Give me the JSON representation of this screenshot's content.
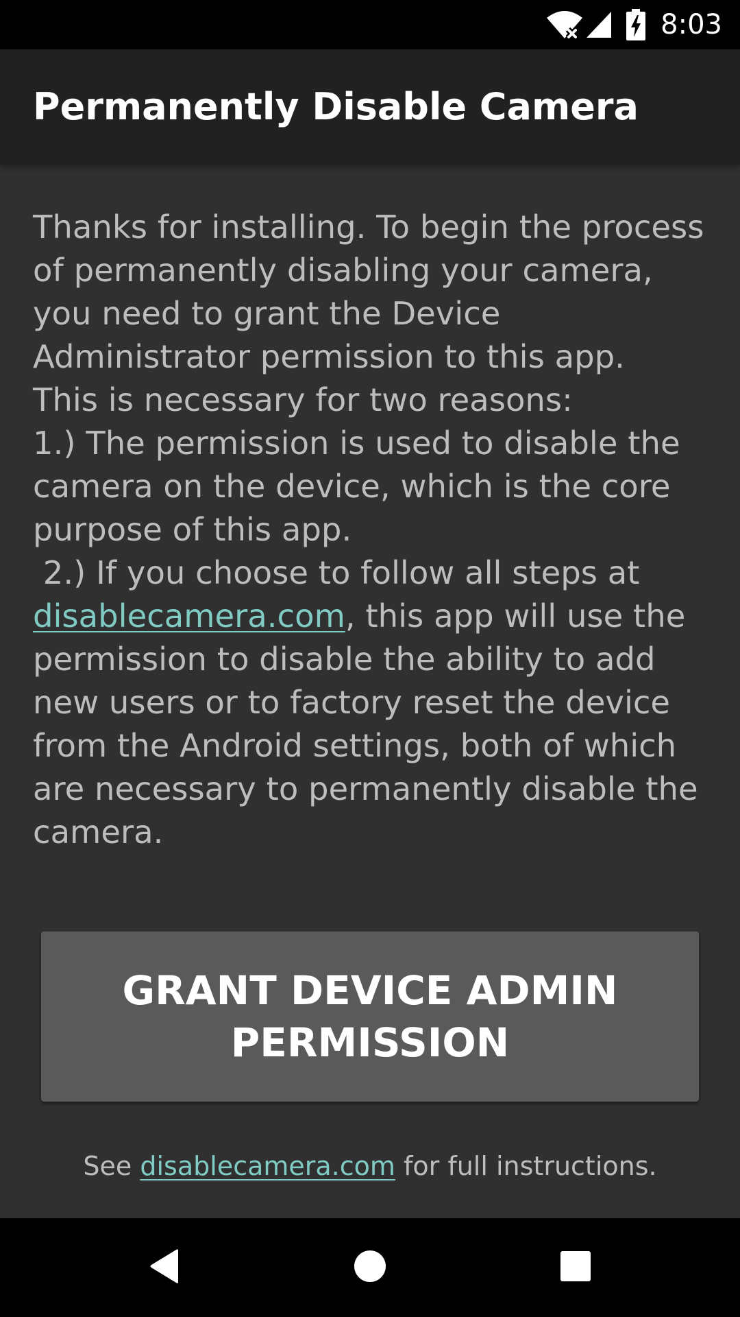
{
  "status_bar": {
    "time": "8:03",
    "icons": [
      "wifi-no-internet-icon",
      "cellular-signal-icon",
      "battery-charging-icon"
    ]
  },
  "app_bar": {
    "title": "Permanently Disable Camera"
  },
  "body": {
    "intro": " Thanks for installing. To begin the process of permanently disabling your camera, you need to grant the Device Administrator permission to this app.",
    "reasons_heading": "This is necessary for two reasons:",
    "reason_1": " 1.) The permission is used to disable the camera on the device, which is the core purpose of this app.",
    "reason_2_prefix": " 2.) If you choose to follow all steps at ",
    "reason_2_link": "disablecamera.com",
    "reason_2_suffix": ", this app will use the permission to disable the ability to add new users or to factory reset the device from the Android settings, both of which are necessary to permanently disable the camera."
  },
  "button": {
    "line_1": "GRANT DEVICE ADMIN",
    "line_2": "PERMISSION"
  },
  "footer": {
    "prefix": "See ",
    "link": "disablecamera.com",
    "suffix": " for full instructions."
  },
  "nav_bar": {
    "icons": [
      "back-icon",
      "home-icon",
      "recents-icon"
    ]
  },
  "colors": {
    "background": "#303030",
    "app_bar": "#212121",
    "link": "#80cbc4",
    "button": "#5a5a5a",
    "body_text": "#bdbdbd"
  }
}
